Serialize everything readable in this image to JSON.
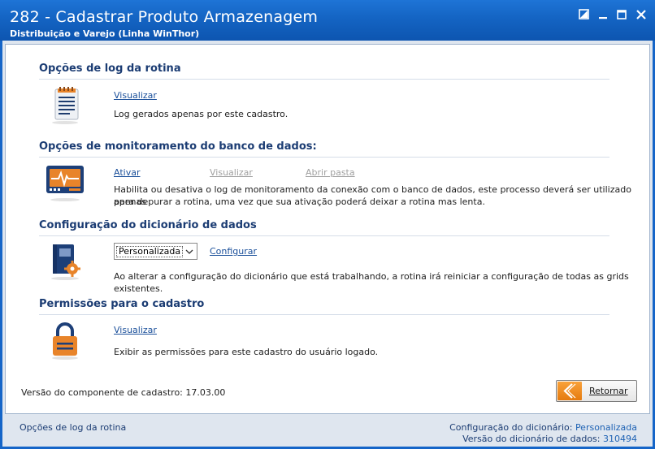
{
  "window": {
    "title": "282 - Cadastrar Produto Armazenagem",
    "subtitle": "Distribuição e Varejo (Linha WinThor)"
  },
  "sections": {
    "log": {
      "title": "Opções de log da rotina",
      "view_link": "Visualizar",
      "description": "Log gerados apenas por este cadastro."
    },
    "monitor": {
      "title": "Opções de monitoramento do banco de dados:",
      "activate_link": "Ativar",
      "view_link": "Visualizar",
      "open_folder_link": "Abrir pasta",
      "description_line1": "Habilita ou desativa o log de monitoramento da conexão com o banco de dados, este processo deverá ser utilizado apenas",
      "description_line2": "para depurar a rotina, uma vez que sua ativação poderá deixar a rotina mas lenta."
    },
    "dictionary": {
      "title": "Configuração do dicionário de dados",
      "selected": "Personalizada",
      "configure_link": "Configurar",
      "description": "Ao alterar a configuração do dicionário que está trabalhando, a rotina irá reiniciar a configuração de todas as grids existentes."
    },
    "permissions": {
      "title": "Permissões para o cadastro",
      "view_link": "Visualizar",
      "description": "Exibir as permissões para este cadastro do usuário logado."
    }
  },
  "footer": {
    "version_text": "Versão do componente de cadastro: 17.03.00",
    "return_button": "Retornar"
  },
  "statusbar": {
    "left": "Opções de log da rotina",
    "dict_config_label": "Configuração do dicionário:",
    "dict_config_value": "Personalizada",
    "dict_version_label": "Versão do dicionário de dados:",
    "dict_version_value": "310494"
  },
  "colors": {
    "titlebar": "#1464c3",
    "section_title": "#1b3c73",
    "link": "#1a4f9a",
    "accent_orange": "#f08a1c"
  }
}
